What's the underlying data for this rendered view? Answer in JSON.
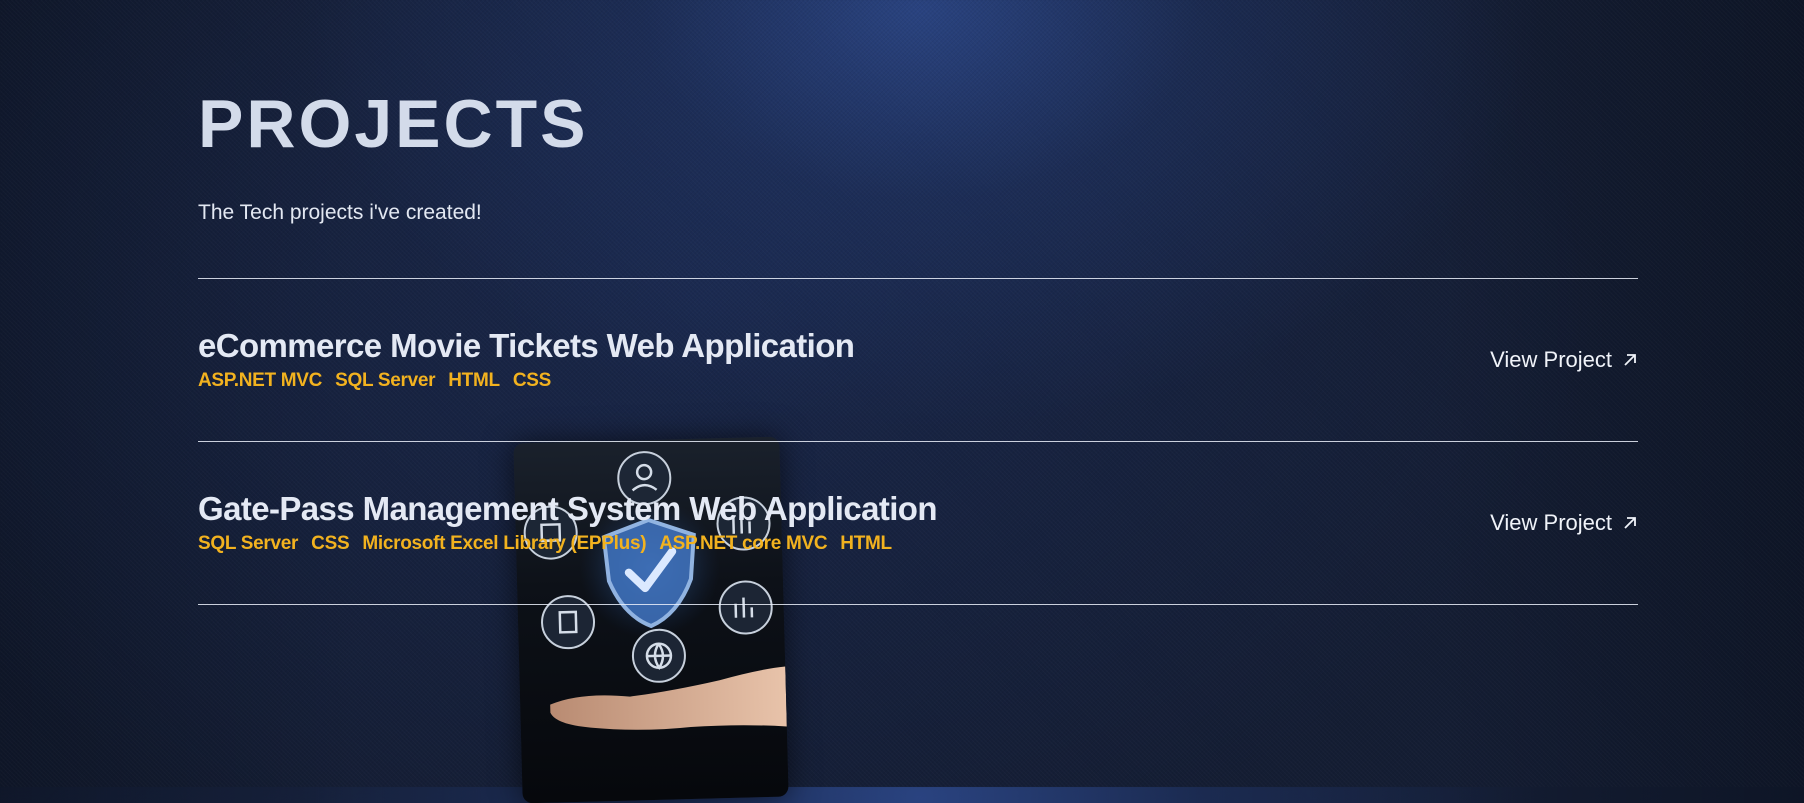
{
  "section": {
    "title": "PROJECTS",
    "subtitle": "The Tech projects i've created!"
  },
  "projects": [
    {
      "title": "eCommerce Movie Tickets Web Application",
      "tags": [
        "ASP.NET MVC",
        "SQL Server",
        "HTML",
        "CSS"
      ],
      "link_label": "View Project",
      "link_icon": "arrow-up-right-icon"
    },
    {
      "title": "Gate-Pass Management System Web Application",
      "tags": [
        "SQL Server",
        "CSS",
        "Microsoft Excel Library (EPPlus)",
        "ASP.NET core MVC",
        "HTML"
      ],
      "link_label": "View Project",
      "link_icon": "arrow-up-right-icon"
    }
  ],
  "colors": {
    "background": "#141d33",
    "accent_tag": "#f2b21f",
    "title": "#d3dbea",
    "text": "#e4e9f4"
  },
  "background_image": {
    "description_icon": "hand-holding-phone-security-icons"
  }
}
